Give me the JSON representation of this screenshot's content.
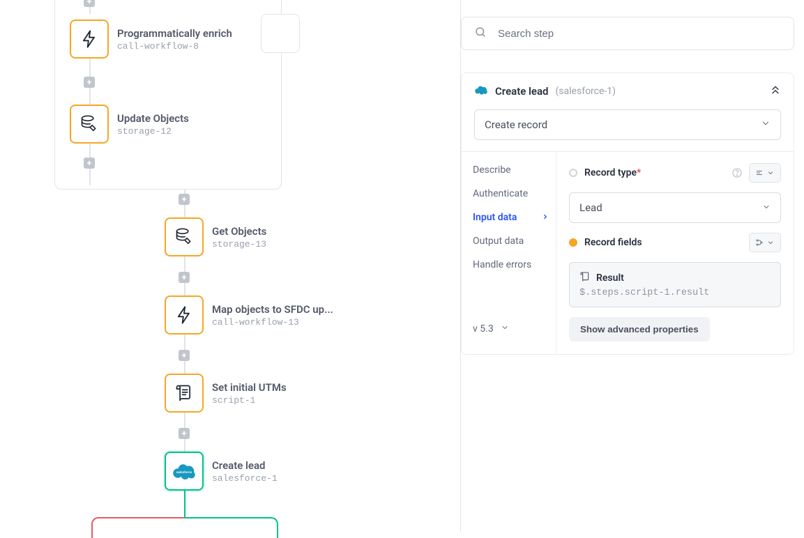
{
  "workflow": {
    "nodes": [
      {
        "id": "enrich",
        "title": "Programmatically enrich",
        "slug": "call-workflow-8",
        "icon": "bolt"
      },
      {
        "id": "update",
        "title": "Update Objects",
        "slug": "storage-12",
        "icon": "db-edit"
      },
      {
        "id": "getobj",
        "title": "Get Objects",
        "slug": "storage-13",
        "icon": "db-edit"
      },
      {
        "id": "map",
        "title": "Map objects to SFDC up...",
        "slug": "call-workflow-13",
        "icon": "bolt"
      },
      {
        "id": "utms",
        "title": "Set initial UTMs",
        "slug": "script-1",
        "icon": "script"
      },
      {
        "id": "create",
        "title": "Create lead",
        "slug": "salesforce-1",
        "icon": "salesforce"
      }
    ]
  },
  "search": {
    "placeholder": "Search step"
  },
  "panel": {
    "title": "Create lead",
    "slug_display": "(salesforce-1)",
    "operation": "Create record",
    "tabs": {
      "describe": "Describe",
      "authenticate": "Authenticate",
      "input": "Input data",
      "output": "Output data",
      "errors": "Handle errors"
    },
    "version": "v 5.3",
    "fields": {
      "record_type_label": "Record type",
      "record_type_value": "Lead",
      "required_star": "*",
      "record_fields_label": "Record fields",
      "result_label": "Result",
      "result_path": "$.steps.script-1.result",
      "advanced_button": "Show advanced properties"
    }
  }
}
